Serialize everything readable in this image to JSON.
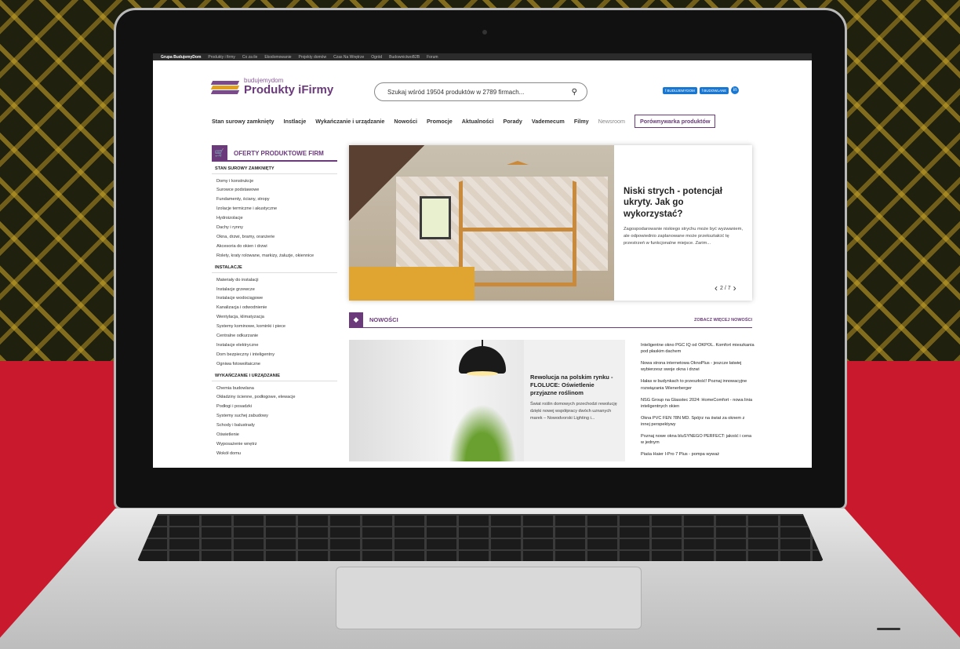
{
  "topbar": {
    "brand": "Grupa BudujemyDom",
    "links": [
      "Produkty i firmy",
      "Co za ile",
      "Ekodomowanie",
      "Projekty domów",
      "Czas Na Wnętrze",
      "Ogród",
      "BudownictwoB2B",
      "Forum"
    ]
  },
  "header": {
    "logo_small": "budujemydom",
    "logo_big": "Produkty iFirmy",
    "search_placeholder": "Szukaj wśród 19504 produktów w 2789 firmach...",
    "social": [
      "BUDUJEMYDOM",
      "BUDOWLANE",
      "in"
    ]
  },
  "nav": {
    "items": [
      "Stan surowy zamknięty",
      "Instlacje",
      "Wykańczanie i urządzanie",
      "Nowości",
      "Promocje",
      "Aktualności",
      "Porady",
      "Vademecum",
      "Filmy"
    ],
    "newsroom": "Newsroom",
    "compare": "Porównywarka produktów"
  },
  "sidebar": {
    "title": "OFERTY PRODUKTOWE FIRM",
    "sections": [
      {
        "name": "STAN SUROWY ZAMKNIĘTY",
        "items": [
          "Domy i konstrukcje",
          "Surowce podstawowe",
          "Fundamenty, ściany, stropy",
          "Izolacje termiczne i akustyczne",
          "Hydroizolacje",
          "Dachy i rynny",
          "Okna, drzwi, bramy, oranżerie",
          "Akcesoria do okien i drzwi",
          "Rolety, kraty rolowane, markizy, żaluzje, okiennice"
        ]
      },
      {
        "name": "INSTALACJE",
        "items": [
          "Materiały do instalacji",
          "Instalacje grzewcze",
          "Instalacje wodociągowe",
          "Kanalizacja i odwodnienie",
          "Wentylacja, klimatyzacja",
          "Systemy kominowe, kominki i piece",
          "Centralne odkurzanie",
          "Instalacje elektryczne",
          "Dom bezpieczny i inteligentny",
          "Ogniwa fotowoltaiczne"
        ]
      },
      {
        "name": "WYKAŃCZANIE I URZĄDZANIE",
        "items": [
          "Chemia budowlana",
          "Okładziny ścienne, podłogowe, elewacje",
          "Podłogi i posadzki",
          "Systemy suchej zabudowy",
          "Schody i balustrady",
          "Oświetlenie",
          "Wyposażenie wnętrz",
          "Wokół domu"
        ]
      }
    ]
  },
  "hero": {
    "title": "Niski strych - potencjał ukryty. Jak go wykorzystać?",
    "desc": "Zagospodarowanie niskiego strychu może być wyzwaniem, ale odpowiednio zaplanowane może przekształcić tę przestrzeń w funkcjonalne miejsce. Zarim...",
    "pager": "2 / 7"
  },
  "news": {
    "title": "NOWOŚCI",
    "see_more": "ZOBACZ WIĘCEJ NOWOŚCI",
    "card_title": "Rewolucja na polskim rynku - FLOLUCE: Oświetlenie przyjazne roślinom",
    "card_desc": "Świat roślin domowych przechodzi rewolucję dzięki nowej współpracy dwóch uznanych marek – Nowodvorski Lighting i...",
    "list": [
      "Inteligentne okno PGC IQ od OKPOL. Komfort mieszkania pod płaskim dachem",
      "Nowa strona internetowa OknoPlus - jeszcze łatwiej wybierzesz swoje okna i drzwi",
      "Hałas w budynkach to przeszłość! Poznaj innowacyjne rozwiązania Wienerberger",
      "NSG Group na Glasstec 2024: HomeComfort - nowa linia inteligentnych okien",
      "Okna PVC FEN 78N MD. Spójrz na świat za oknem z innej perspektywy",
      "Poznaj nowe okna bluSYNEGO PERFECT: jakość i cena w jednym",
      "Piaśa Haier I-Pro 7 Plus - pompa wyważ"
    ]
  },
  "colors": {
    "brand": "#6a3a7a",
    "background_red": "#c81a2c",
    "accent_gold": "#d2aa28"
  }
}
